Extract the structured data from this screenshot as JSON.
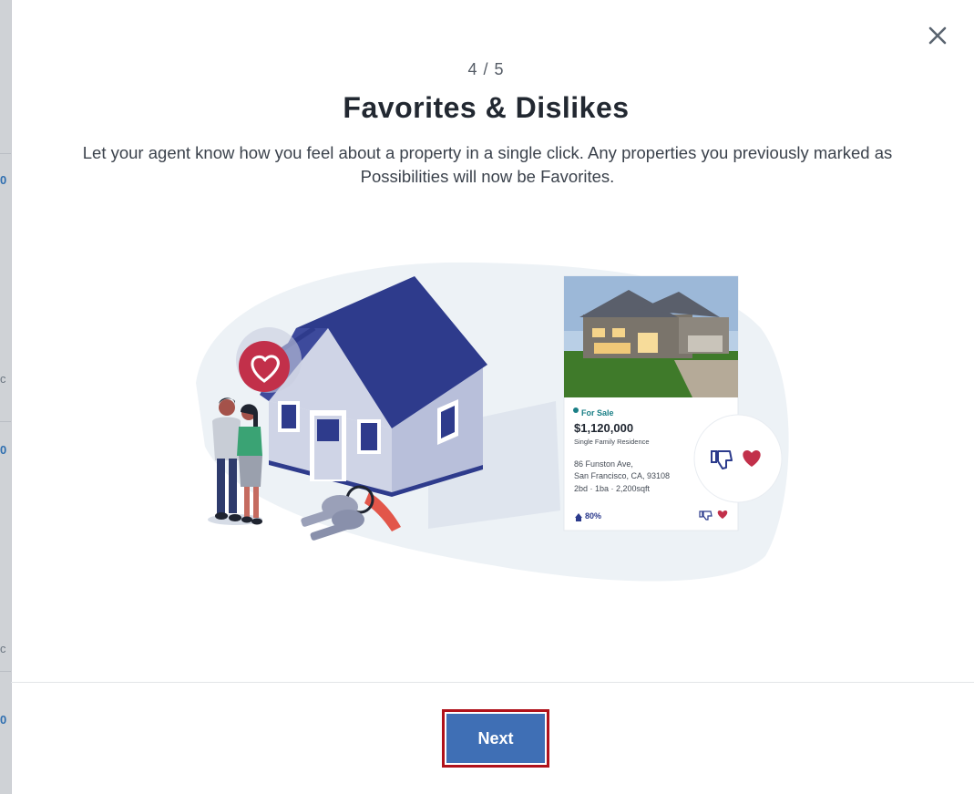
{
  "modal": {
    "step": "4 / 5",
    "title": "Favorites & Dislikes",
    "description": "Let your agent know how you feel about a property in a single click. Any properties you previously marked as Possibilities will now be Favorites.",
    "close_icon": "close-icon"
  },
  "listing_card": {
    "status": "For Sale",
    "price": "$1,120,000",
    "type": "Single Family Residence",
    "address_line1": "86 Funston Ave,",
    "address_line2": "San Francisco, CA, 93108",
    "specs": "2bd · 1ba · 2,200sqft",
    "match": "80%",
    "icons": [
      "thumbs-down-icon",
      "heart-icon",
      "home-icon"
    ]
  },
  "footer": {
    "next_label": "Next"
  },
  "colors": {
    "primary": "#3f6fb5",
    "highlight": "#b0121b",
    "house_roof": "#2e3b8c",
    "heart": "#c2304a"
  }
}
